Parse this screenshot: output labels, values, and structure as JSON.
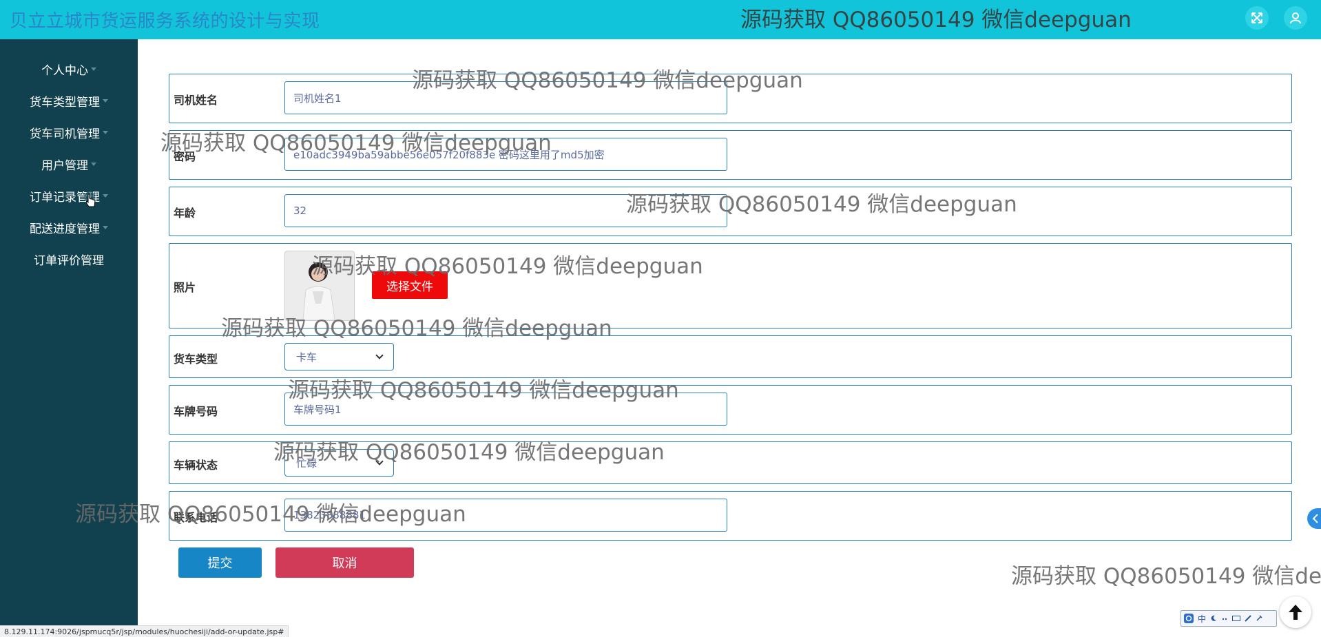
{
  "header": {
    "title": "贝立立城市货运服务系统的设计与实现",
    "fullscreen_icon": "expand-icon",
    "user_icon": "user-icon"
  },
  "sidebar": {
    "items": [
      {
        "label": "个人中心"
      },
      {
        "label": "货车类型管理"
      },
      {
        "label": "货车司机管理"
      },
      {
        "label": "用户管理"
      },
      {
        "label": "订单记录管理"
      },
      {
        "label": "配送进度管理"
      },
      {
        "label": "订单评价管理"
      }
    ]
  },
  "form": {
    "driver_name": {
      "label": "司机姓名",
      "value": "司机姓名1"
    },
    "password": {
      "label": "密码",
      "value": "e10adc3949ba59abbe56e057f20f883e 密码这里用了md5加密"
    },
    "age": {
      "label": "年龄",
      "value": "32"
    },
    "photo": {
      "label": "照片",
      "button": "选择文件"
    },
    "truck_type": {
      "label": "货车类型",
      "value": "卡车"
    },
    "plate": {
      "label": "车牌号码",
      "value": "车牌号码1"
    },
    "vehicle_status": {
      "label": "车辆状态",
      "value": "忙碌"
    },
    "phone": {
      "label": "联系电话",
      "value": "13823888881"
    },
    "submit": "提交",
    "cancel": "取消"
  },
  "watermark_text": "源码获取 QQ86050149 微信deepguan",
  "statusbar": {
    "url": "8.129.11.174:9026/jspmucq5r/jsp/modules/huochesiji/add-or-update.jsp#"
  },
  "ime": {
    "label": "中"
  },
  "colors": {
    "header_bg": "#12c4d9",
    "sidebar_bg": "#11414f",
    "border": "#2a7fb0",
    "submit": "#1786c7",
    "cancel": "#d13b58",
    "file_button": "#ee0a0a"
  }
}
